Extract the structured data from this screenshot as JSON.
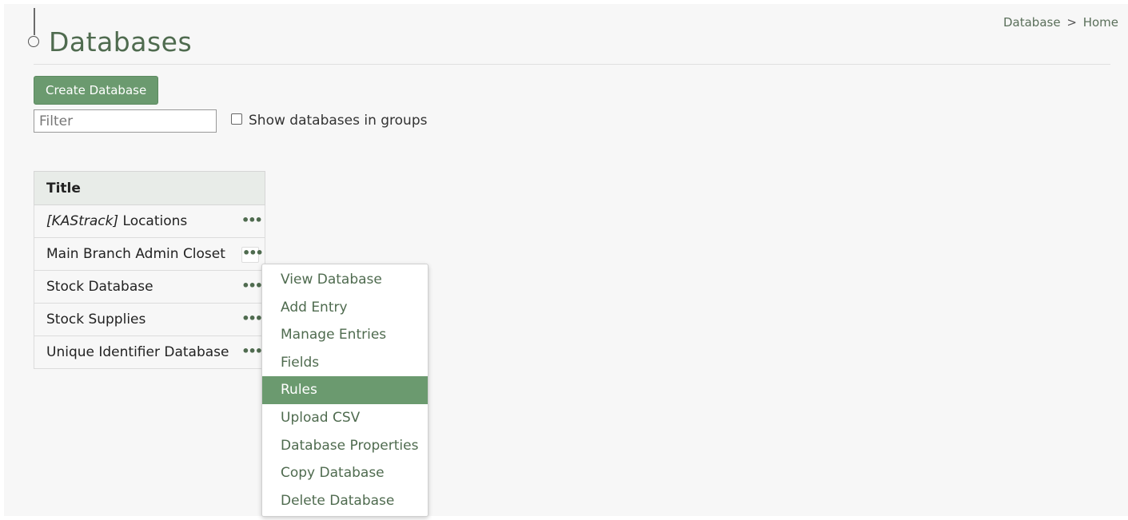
{
  "breadcrumb": {
    "section": "Database",
    "separator": ">",
    "current": "Home"
  },
  "page": {
    "title": "Databases"
  },
  "toolbar": {
    "create_label": "Create Database",
    "filter_placeholder": "Filter",
    "groups_checkbox_label": "Show databases in groups",
    "groups_checked": false
  },
  "table": {
    "header": "Title",
    "rows": [
      {
        "tag": "[KAStrack]",
        "name": "Locations"
      },
      {
        "name": "Main Branch Admin Closet"
      },
      {
        "name": "Stock Database"
      },
      {
        "name": "Stock Supplies"
      },
      {
        "name": "Unique Identifier Database"
      }
    ],
    "row_menu_icon": "ellipsis-icon"
  },
  "context_menu": {
    "items": [
      "View Database",
      "Add Entry",
      "Manage Entries",
      "Fields",
      "Rules",
      "Upload CSV",
      "Database Properties",
      "Copy Database",
      "Delete Database"
    ],
    "highlighted": "Rules"
  },
  "colors": {
    "accent": "#6b9a6f",
    "title": "#4f6b4f",
    "background": "#f7f7f7"
  }
}
